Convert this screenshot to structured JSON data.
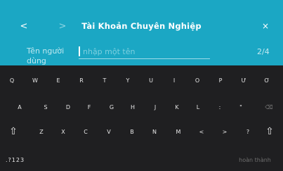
{
  "header": {
    "back_label": "<",
    "forward_label": ">",
    "title": "Tài Khoản Chuyên Nghiệp",
    "close_label": "×"
  },
  "form": {
    "field_label": "Tên người dùng",
    "input_value": "",
    "input_placeholder": "nhập một tên",
    "step_counter": "2/4"
  },
  "keyboard": {
    "row1": [
      "Q",
      "W",
      "E",
      "R",
      "T",
      "Y",
      "U",
      "I",
      "O",
      "P",
      "Ư",
      "Ơ"
    ],
    "row2": [
      "A",
      "S",
      "D",
      "F",
      "G",
      "H",
      "J",
      "K",
      "L",
      ":",
      "\"",
      "⌫"
    ],
    "row3": [
      "⇧",
      "Z",
      "X",
      "C",
      "V",
      "B",
      "N",
      "M",
      "<",
      ">",
      "?",
      "⇧"
    ],
    "numbers_label": ".?123",
    "done_label": "hoàn thành"
  },
  "colors": {
    "header_bg": "#1ba7c4",
    "keyboard_bg": "#1f1f21"
  }
}
